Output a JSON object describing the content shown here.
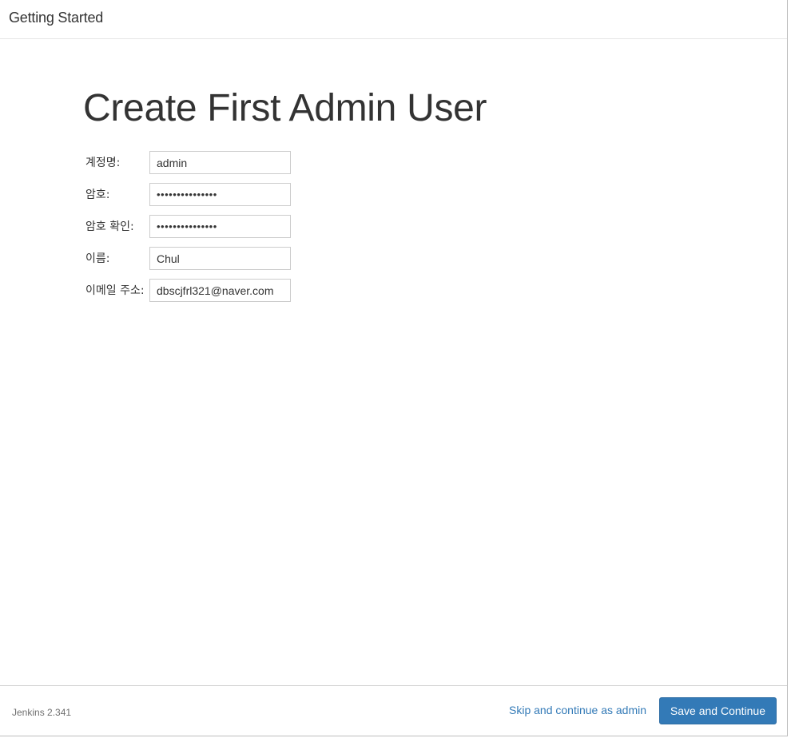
{
  "header": {
    "title": "Getting Started"
  },
  "main": {
    "title": "Create First Admin User",
    "fields": [
      {
        "label": "계정명:",
        "value": "admin",
        "type": "text"
      },
      {
        "label": "암호:",
        "value": "•••••••••••••••",
        "type": "password"
      },
      {
        "label": "암호 확인:",
        "value": "•••••••••••••••",
        "type": "password"
      },
      {
        "label": "이름:",
        "value": "Chul",
        "type": "text"
      },
      {
        "label": "이메일 주소:",
        "value": "dbscjfrl321@naver.com",
        "type": "text"
      }
    ]
  },
  "footer": {
    "version": "Jenkins 2.341",
    "skip_label": "Skip and continue as admin",
    "save_label": "Save and Continue"
  },
  "colors": {
    "accent": "#337ab7",
    "text": "#333333"
  }
}
